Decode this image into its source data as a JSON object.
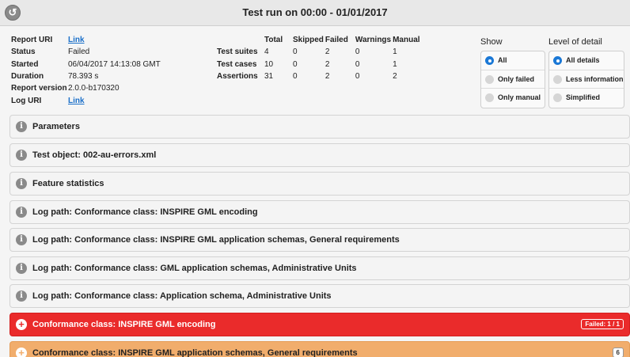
{
  "header": {
    "title": "Test run on 00:00 - 01/01/2017",
    "back_icon": "back-arrow-icon"
  },
  "info": {
    "report_uri_label": "Report URI",
    "report_uri_link": "Link",
    "status_label": "Status",
    "status_value": "Failed",
    "started_label": "Started",
    "started_value": "06/04/2017 14:13:08 GMT",
    "duration_label": "Duration",
    "duration_value": "78.393 s",
    "version_label": "Report version",
    "version_value": "2.0.0-b170320",
    "log_uri_label": "Log URI",
    "log_uri_link": "Link"
  },
  "stats": {
    "headers": [
      "Total",
      "Skipped",
      "Failed",
      "Warnings",
      "Manual"
    ],
    "rows": [
      {
        "label": "Test suites",
        "values": [
          "4",
          "0",
          "2",
          "0",
          "1"
        ]
      },
      {
        "label": "Test cases",
        "values": [
          "10",
          "0",
          "2",
          "0",
          "1"
        ]
      },
      {
        "label": "Assertions",
        "values": [
          "31",
          "0",
          "2",
          "0",
          "2"
        ]
      }
    ]
  },
  "show": {
    "title": "Show",
    "options": [
      "All",
      "Only failed",
      "Only manual"
    ],
    "selected": "All"
  },
  "detail": {
    "title": "Level of detail",
    "options": [
      "All details",
      "Less information",
      "Simplified"
    ],
    "selected": "All details"
  },
  "panels": [
    {
      "label": "Parameters"
    },
    {
      "label": "Test object: 002-au-errors.xml"
    },
    {
      "label": "Feature statistics"
    },
    {
      "label": "Log path: Conformance class: INSPIRE GML encoding"
    },
    {
      "label": "Log path: Conformance class: INSPIRE GML application schemas, General requirements"
    },
    {
      "label": "Log path: Conformance class: GML application schemas, Administrative Units"
    },
    {
      "label": "Log path: Conformance class: Application schema, Administrative Units"
    }
  ],
  "failed_panel": {
    "label": "Conformance class: INSPIRE GML encoding",
    "badge": "Failed: 1 / 1"
  },
  "warn_panel": {
    "label": "Conformance class: INSPIRE GML application schemas, General requirements",
    "badge": "6"
  },
  "colors": {
    "failed": "#ea2b2b",
    "warning": "#f1ad6c",
    "link": "#1a6fc9",
    "radio_selected": "#1a78d6"
  }
}
